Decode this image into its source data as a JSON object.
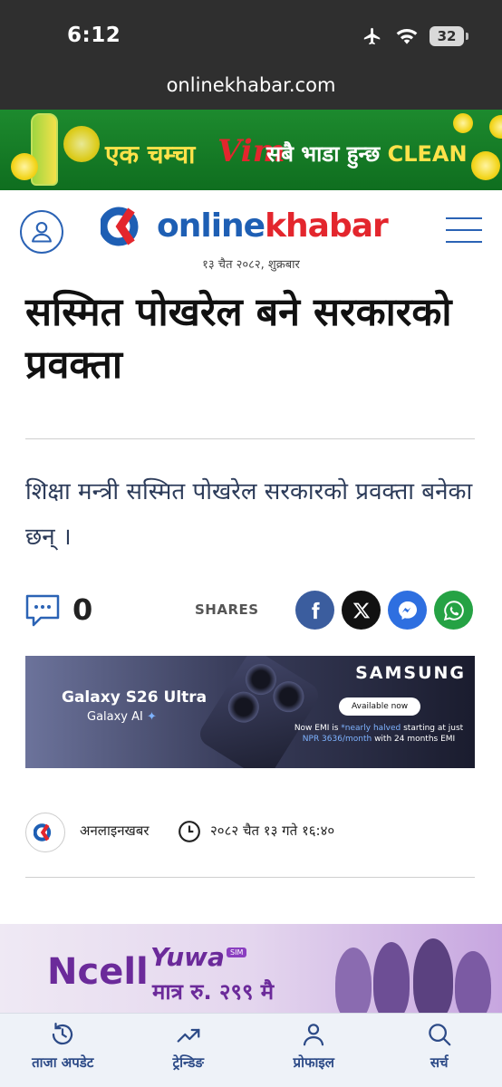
{
  "status_bar": {
    "time": "6:12",
    "battery": "32"
  },
  "browser": {
    "url": "onlinekhabar.com"
  },
  "ad_top": {
    "text_left": "एक चम्चा",
    "logo": "Vim",
    "text_right": "सबै भाडा हुन्छ",
    "text_clean": "CLEAN"
  },
  "header": {
    "logo_mark": "OK",
    "logo_online": "online",
    "logo_khabar": "khabar",
    "date": "१३ चैत २०८२, शुक्रबार"
  },
  "article": {
    "headline": "सस्मित पोखरेल बने सरकारको प्रवक्ता",
    "summary": "शिक्षा मन्त्री सस्मित पोखरेल सरकारको प्रवक्ता बनेका छन् ।",
    "comment_count": "0",
    "shares_label": "SHARES",
    "author": "अनलाइनखबर",
    "published": "२०८२ चैत १३ गते १६:४०"
  },
  "ad_samsung": {
    "model": "Galaxy S26 Ultra",
    "ai_label": "Galaxy AI",
    "brand": "SAMSUNG",
    "cta": "Available now",
    "emi_line1_a": "Now EMI is ",
    "emi_line1_b": "*nearly halved",
    "emi_line1_c": " starting at just",
    "emi_line2_a": "NPR 3636/month",
    "emi_line2_b": " with 24 months EMI"
  },
  "ad_ncell": {
    "brand": "Ncell",
    "product": "Yuwa",
    "sim": "SIM",
    "price": "मात्र रु. २९९ मै"
  },
  "bottom_nav": [
    {
      "label": "ताजा अपडेट",
      "icon": "clock-refresh-icon"
    },
    {
      "label": "ट्रेन्डिङ",
      "icon": "trending-icon"
    },
    {
      "label": "प्रोफाइल",
      "icon": "profile-icon"
    },
    {
      "label": "सर्च",
      "icon": "search-icon"
    }
  ],
  "colors": {
    "brand_blue": "#1e5fb4",
    "brand_red": "#e3262d",
    "facebook": "#3b5d9e",
    "messenger": "#2e6fe0",
    "whatsapp": "#25a244"
  }
}
